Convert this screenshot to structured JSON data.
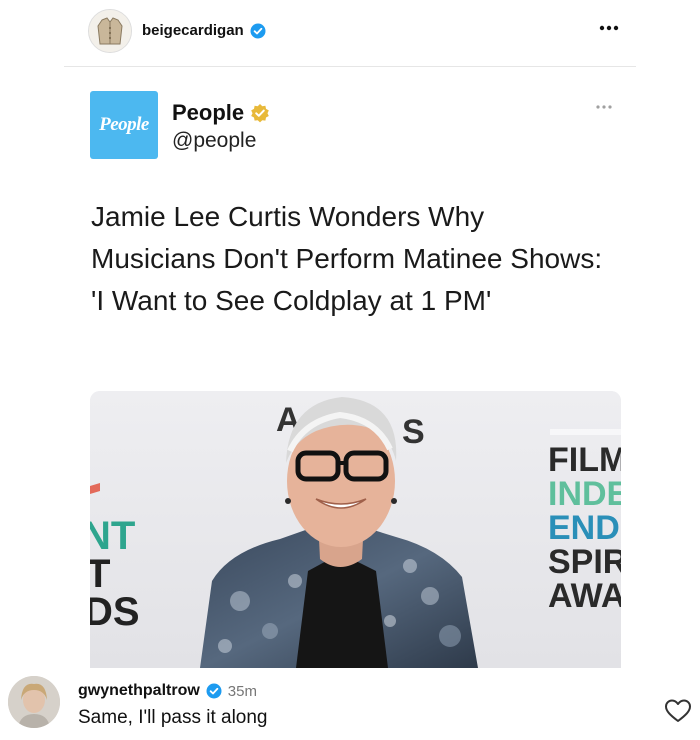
{
  "post": {
    "username": "beigecardigan",
    "more_icon": "more-horizontal-icon"
  },
  "embedded": {
    "brand_logo_text": "People",
    "name": "People",
    "handle": "@people",
    "headline": "Jamie Lee Curtis Wonders Why Musicians Don't Perform Matinee Shows: 'I Want to See Coldplay at 1 PM'",
    "photo_backdrop_left": [
      "NT",
      "T",
      "DS"
    ],
    "photo_backdrop_right": [
      "FILM",
      "INDE",
      "ENDI",
      "SPIR",
      "AWAI"
    ]
  },
  "comment": {
    "username": "gwynethpaltrow",
    "time": "35m",
    "text": "Same, I'll pass it along"
  },
  "colors": {
    "verified_blue": "#1d9bf0",
    "verified_gold": "#e8b93a",
    "people_blue": "#4cb8f0"
  }
}
